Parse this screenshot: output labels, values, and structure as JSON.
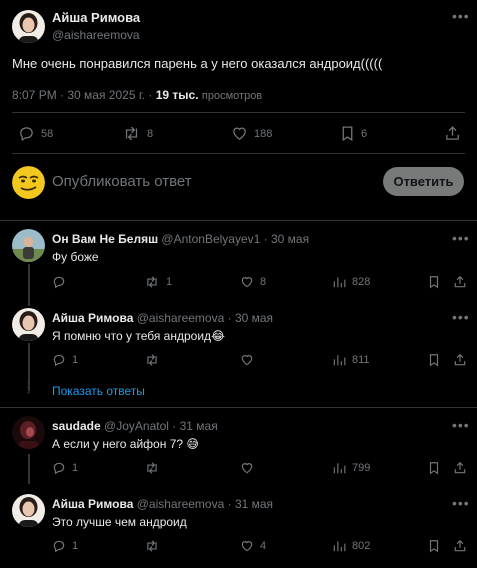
{
  "main_post": {
    "author_name": "Айша Римова",
    "handle": "@aishareemova",
    "text": "Мне очень понравился парень а у него оказался андроид(((((",
    "timestamp": "8:07 PM · 30 мая 2025 г. · ",
    "views_count": "19 тыс.",
    "views_label": "просмотров",
    "replies": "58",
    "reposts": "8",
    "likes": "188",
    "bookmarks": "6"
  },
  "composer": {
    "placeholder": "Опубликовать ответ",
    "button_label": "Ответить"
  },
  "replies": [
    {
      "author_name": "Он Вам Не Беляш",
      "handle": "@AntonBelyayev1",
      "date": "· 30 мая",
      "text": "Фу боже",
      "replies": "",
      "reposts": "1",
      "likes": "8",
      "views": "828"
    },
    {
      "author_name": "Айша Римова",
      "handle": "@aishareemova",
      "date": "· 30 мая",
      "text": "Я помню что у тебя андроид😂",
      "replies": "1",
      "reposts": "",
      "likes": "",
      "views": "811"
    },
    {
      "author_name": "saudade",
      "handle": "@JoyAnatol",
      "date": "· 31 мая",
      "text": "А если у него айфон 7? 😅",
      "replies": "1",
      "reposts": "",
      "likes": "",
      "views": "799"
    },
    {
      "author_name": "Айша Римова",
      "handle": "@aishareemova",
      "date": "· 31 мая",
      "text": "Это лучше чем андроид",
      "replies": "1",
      "reposts": "",
      "likes": "4",
      "views": "802"
    }
  ],
  "show_replies_label": "Показать ответы",
  "colors": {
    "background": "#000000",
    "text": "#e7e9ea",
    "muted": "#71767b",
    "link": "#1d9bf0",
    "divider": "#2f3336",
    "reply_button": "#787a7a"
  }
}
